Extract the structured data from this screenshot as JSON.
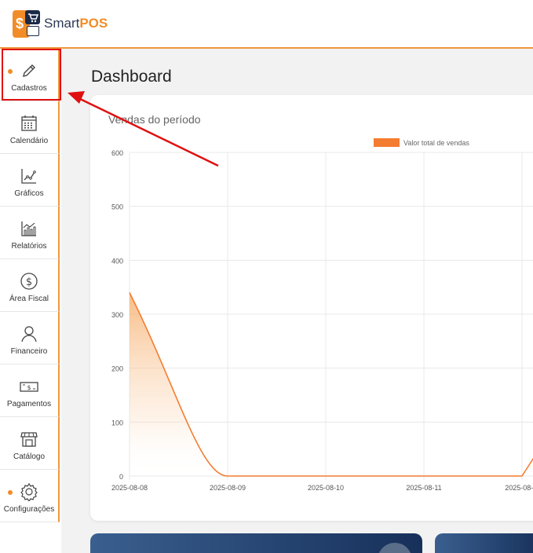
{
  "brand": {
    "name_part1": "Smart",
    "name_part2": "POS"
  },
  "sidebar": {
    "items": [
      {
        "label": "Cadastros",
        "icon": "pencil-icon",
        "dot": true
      },
      {
        "label": "Calendário",
        "icon": "calendar-icon",
        "dot": false
      },
      {
        "label": "Gráficos",
        "icon": "line-chart-icon",
        "dot": false
      },
      {
        "label": "Relatórios",
        "icon": "bar-chart-icon",
        "dot": false
      },
      {
        "label": "Área Fiscal",
        "icon": "dollar-circle-icon",
        "dot": false
      },
      {
        "label": "Financeiro",
        "icon": "user-icon",
        "dot": false
      },
      {
        "label": "Pagamentos",
        "icon": "banknote-icon",
        "dot": false
      },
      {
        "label": "Catálogo",
        "icon": "store-icon",
        "dot": false
      },
      {
        "label": "Configurações",
        "icon": "gear-icon",
        "dot": true
      }
    ]
  },
  "main": {
    "title": "Dashboard"
  },
  "colors": {
    "accent": "#f28c28",
    "navy": "#1b2a48",
    "highlight": "#e01010"
  },
  "chart_data": {
    "type": "area",
    "title": "Vendas do período",
    "categories": [
      "2025-08-08",
      "2025-08-09",
      "2025-08-10",
      "2025-08-11",
      "2025-08-..."
    ],
    "series": [
      {
        "name": "Valor total de vendas",
        "values": [
          340,
          0,
          0,
          0,
          0
        ],
        "color": "#f47c30"
      }
    ],
    "ylim": [
      0,
      600
    ],
    "yticks": [
      "0",
      "100",
      "200",
      "300",
      "400",
      "500",
      "600"
    ],
    "grid": true,
    "legend": "top"
  }
}
